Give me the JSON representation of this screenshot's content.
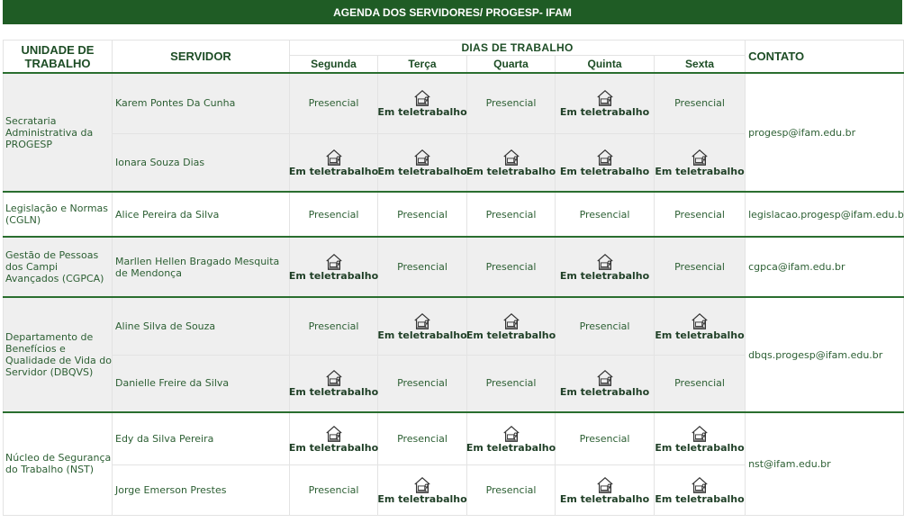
{
  "title": "AGENDA DOS SERVIDORES/ PROGESP- IFAM",
  "headers": {
    "unidade": "UNIDADE DE TRABALHO",
    "servidor": "SERVIDOR",
    "dias": "DIAS DE TRABALHO",
    "contato": "CONTATO",
    "days": [
      "Segunda",
      "Terça",
      "Quarta",
      "Quinta",
      "Sexta"
    ]
  },
  "icon": "teleworker-icon",
  "colors": {
    "header_bar": "#1f5c25",
    "accent": "#2a6e2f",
    "gray_row": "#efefef"
  },
  "units": [
    {
      "name": "Secrataria Administrativa da PROGESP",
      "contact": "progesp@ifam.edu.br",
      "rows": [
        {
          "servidor": "Karem Pontes Da Cunha",
          "days": [
            "Presencial",
            "Em teletrabalho",
            "Presencial",
            "Em teletrabalho",
            "Presencial"
          ]
        },
        {
          "servidor": "Ionara Souza Dias",
          "days": [
            "Em teletrabalho",
            "Em teletrabalho",
            "Em teletrabalho",
            "Em teletrabalho",
            "Em teletrabalho"
          ]
        }
      ]
    },
    {
      "name": "Legislação e Normas (CGLN)",
      "contact": "legislacao.progesp@ifam.edu.br",
      "rows": [
        {
          "servidor": "Alice Pereira da Silva",
          "days": [
            "Presencial",
            "Presencial",
            "Presencial",
            "Presencial",
            "Presencial"
          ]
        }
      ]
    },
    {
      "name": "Gestão de Pessoas dos Campi Avançados (CGPCA)",
      "contact": "cgpca@ifam.edu.br",
      "rows": [
        {
          "servidor": "Marllen Hellen Bragado Mesquita de Mendonça",
          "days": [
            "Em teletrabalho",
            "Presencial",
            "Presencial",
            "Em teletrabalho",
            "Presencial"
          ]
        }
      ]
    },
    {
      "name": "Departamento de Benefícios e Qualidade de Vida do Servidor (DBQVS)",
      "contact": "dbqs.progesp@ifam.edu.br",
      "rows": [
        {
          "servidor": "Aline Silva de Souza",
          "days": [
            "Presencial",
            "Em teletrabalho",
            "Em teletrabalho",
            "Presencial",
            "Em teletrabalho"
          ]
        },
        {
          "servidor": "Danielle Freire da Silva",
          "days": [
            "Em teletrabalho",
            "Presencial",
            "Presencial",
            "Em teletrabalho",
            "Presencial"
          ]
        }
      ]
    },
    {
      "name": "Núcleo de Segurança do Trabalho (NST)",
      "contact": "nst@ifam.edu.br",
      "rows": [
        {
          "servidor": "Edy da Silva Pereira",
          "days": [
            "Em teletrabalho",
            "Presencial",
            "Em teletrabalho",
            "Presencial",
            "Em teletrabalho"
          ]
        },
        {
          "servidor": "Jorge Emerson Prestes",
          "days": [
            "Presencial",
            "Em teletrabalho",
            "Presencial",
            "Em teletrabalho",
            "Em teletrabalho"
          ]
        }
      ]
    }
  ]
}
